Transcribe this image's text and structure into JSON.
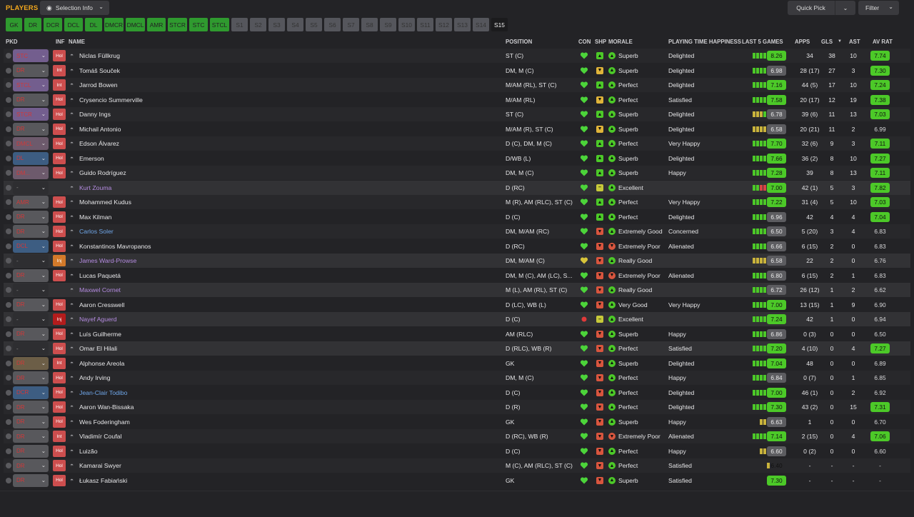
{
  "header": {
    "title": "PLAYERS",
    "selection_info": "Selection Info",
    "quick_pick": "Quick Pick",
    "filter": "Filter"
  },
  "tabs": [
    "GK",
    "DR",
    "DCR",
    "DCL",
    "DL",
    "DMCR",
    "DMCL",
    "AMR",
    "STCR",
    "STC",
    "STCL",
    "S1",
    "S2",
    "S3",
    "S4",
    "S5",
    "S6",
    "S7",
    "S8",
    "S9",
    "S10",
    "S11",
    "S12",
    "S13",
    "S14",
    "S15"
  ],
  "active_tab": "S15",
  "columns": {
    "pkd": "PKD",
    "inf": "INF",
    "name": "NAME",
    "position": "POSITION",
    "con": "CON",
    "shp": "SHP",
    "morale": "MORALE",
    "pth": "PLAYING TIME HAPPINESS",
    "last5": "LAST 5 GAMES",
    "apps": "APPS",
    "gls": "GLS",
    "sort_indicator": "▼",
    "ast": "AST",
    "avrat": "AV RAT"
  },
  "colors": {
    "accent": "#f2a71d",
    "good": "#4cc928",
    "average": "#a8ac2c",
    "danger": "#cd4e4e"
  },
  "players": [
    {
      "sel": "STC",
      "sel_color": "purple",
      "inf": "Hol",
      "name": "Niclas Füllkrug",
      "name_color": "default",
      "position": "ST (C)",
      "con": "heart-green",
      "shp": "up",
      "morale": "Superb",
      "morale_icon": "up",
      "pth": "Delighted",
      "last5": [
        "g",
        "g",
        "g",
        "g",
        "g"
      ],
      "rating": "8.26",
      "rating_color": "g",
      "apps": "34",
      "gls": "38",
      "ast": "10",
      "avrat": "7.74",
      "avrat_color": "g"
    },
    {
      "sel": "DR",
      "sel_color": "grey",
      "inf": "Int",
      "name": "Tomáš Souček",
      "name_color": "default",
      "position": "DM, M (C)",
      "con": "heart-green",
      "shp": "down",
      "morale": "Superb",
      "morale_icon": "up",
      "pth": "Delighted",
      "last5": [
        "g",
        "g",
        "g",
        "g",
        "g"
      ],
      "rating": "6.98",
      "rating_color": "n",
      "apps": "28 (17)",
      "gls": "27",
      "ast": "3",
      "avrat": "7.30",
      "avrat_color": "g"
    },
    {
      "sel": "STCL",
      "sel_color": "purple",
      "inf": "Int",
      "name": "Jarrod Bowen",
      "name_color": "default",
      "position": "M/AM (RL), ST (C)",
      "con": "heart-green",
      "shp": "up",
      "morale": "Perfect",
      "morale_icon": "up",
      "pth": "Delighted",
      "last5": [
        "g",
        "g",
        "g",
        "g",
        "g"
      ],
      "rating": "7.16",
      "rating_color": "g",
      "apps": "44 (5)",
      "gls": "17",
      "ast": "10",
      "avrat": "7.24",
      "avrat_color": "g"
    },
    {
      "sel": "DR",
      "sel_color": "grey",
      "inf": "Hol",
      "name": "Crysencio Summerville",
      "name_color": "default",
      "position": "M/AM (RL)",
      "con": "heart-green",
      "shp": "down",
      "morale": "Perfect",
      "morale_icon": "up",
      "pth": "Satisfied",
      "last5": [
        "g",
        "g",
        "g",
        "g",
        "g"
      ],
      "rating": "7.58",
      "rating_color": "g",
      "apps": "20 (17)",
      "gls": "12",
      "ast": "19",
      "avrat": "7.38",
      "avrat_color": "g"
    },
    {
      "sel": "STCR",
      "sel_color": "purple",
      "inf": "Hol",
      "name": "Danny Ings",
      "name_color": "default",
      "position": "ST (C)",
      "con": "heart-green",
      "shp": "up",
      "morale": "Superb",
      "morale_icon": "up",
      "pth": "Delighted",
      "last5": [
        "y",
        "y",
        "y",
        "g",
        "g"
      ],
      "rating": "6.78",
      "rating_color": "n",
      "apps": "39 (6)",
      "gls": "11",
      "ast": "13",
      "avrat": "7.03",
      "avrat_color": "g"
    },
    {
      "sel": "DR",
      "sel_color": "grey",
      "inf": "Hol",
      "name": "Michail Antonio",
      "name_color": "default",
      "position": "M/AM (R), ST (C)",
      "con": "heart-green",
      "shp": "down",
      "morale": "Superb",
      "morale_icon": "up",
      "pth": "Delighted",
      "last5": [
        "y",
        "y",
        "y",
        "y",
        "g"
      ],
      "rating": "6.58",
      "rating_color": "n",
      "apps": "20 (21)",
      "gls": "11",
      "ast": "2",
      "avrat": "6.99",
      "avrat_color": "none"
    },
    {
      "sel": "DMCL",
      "sel_color": "mauve",
      "inf": "Hol",
      "name": "Edson Álvarez",
      "name_color": "default",
      "position": "D (C), DM, M (C)",
      "con": "heart-green",
      "shp": "up",
      "morale": "Perfect",
      "morale_icon": "up",
      "pth": "Very Happy",
      "last5": [
        "g",
        "g",
        "g",
        "g",
        "g"
      ],
      "rating": "7.70",
      "rating_color": "g",
      "apps": "32 (6)",
      "gls": "9",
      "ast": "3",
      "avrat": "7.11",
      "avrat_color": "g"
    },
    {
      "sel": "DL",
      "sel_color": "blue",
      "inf": "Hol",
      "name": "Emerson",
      "name_color": "default",
      "position": "D/WB (L)",
      "con": "heart-green",
      "shp": "up",
      "morale": "Superb",
      "morale_icon": "up",
      "pth": "Delighted",
      "last5": [
        "g",
        "g",
        "g",
        "g",
        "g"
      ],
      "rating": "7.66",
      "rating_color": "g",
      "apps": "36 (2)",
      "gls": "8",
      "ast": "10",
      "avrat": "7.27",
      "avrat_color": "g"
    },
    {
      "sel": "DM...",
      "sel_color": "mauve",
      "inf": "Hol",
      "name": "Guido Rodríguez",
      "name_color": "default",
      "position": "DM, M (C)",
      "con": "heart-green",
      "shp": "up",
      "morale": "Superb",
      "morale_icon": "up",
      "pth": "Happy",
      "last5": [
        "g",
        "g",
        "g",
        "g",
        "g"
      ],
      "rating": "7.28",
      "rating_color": "g",
      "apps": "39",
      "gls": "8",
      "ast": "13",
      "avrat": "7.11",
      "avrat_color": "g"
    },
    {
      "sel": "-",
      "sel_color": "dark",
      "inf": "",
      "name": "Kurt Zouma",
      "name_color": "purple",
      "position": "D (RC)",
      "con": "heart-green",
      "shp": "neutral",
      "morale": "Excellent",
      "morale_icon": "up",
      "pth": "",
      "last5": [
        "g",
        "g",
        "r",
        "r",
        "g"
      ],
      "rating": "7.00",
      "rating_color": "g",
      "apps": "42 (1)",
      "gls": "5",
      "ast": "3",
      "avrat": "7.82",
      "avrat_color": "g"
    },
    {
      "sel": "AMR",
      "sel_color": "grey",
      "inf": "Hol",
      "name": "Mohammed Kudus",
      "name_color": "default",
      "position": "M (R), AM (RLC), ST (C)",
      "con": "heart-green",
      "shp": "up",
      "morale": "Perfect",
      "morale_icon": "up",
      "pth": "Very Happy",
      "last5": [
        "g",
        "g",
        "g",
        "g",
        "g"
      ],
      "rating": "7.22",
      "rating_color": "g",
      "apps": "31 (4)",
      "gls": "5",
      "ast": "10",
      "avrat": "7.03",
      "avrat_color": "g"
    },
    {
      "sel": "DR",
      "sel_color": "grey",
      "inf": "Hol",
      "name": "Max Kilman",
      "name_color": "default",
      "position": "D (C)",
      "con": "heart-green",
      "shp": "up",
      "morale": "Perfect",
      "morale_icon": "up",
      "pth": "Delighted",
      "last5": [
        "g",
        "g",
        "g",
        "g",
        "g"
      ],
      "rating": "6.96",
      "rating_color": "n",
      "apps": "42",
      "gls": "4",
      "ast": "4",
      "avrat": "7.04",
      "avrat_color": "g"
    },
    {
      "sel": "DR",
      "sel_color": "grey",
      "inf": "Hol",
      "name": "Carlos Soler",
      "name_color": "blue",
      "position": "DM, M/AM (RC)",
      "con": "heart-green",
      "shp": "down-red",
      "morale": "Extremely Good",
      "morale_icon": "up",
      "pth": "Concerned",
      "last5": [
        "g",
        "g",
        "g",
        "g",
        "g"
      ],
      "rating": "6.50",
      "rating_color": "n",
      "apps": "5 (20)",
      "gls": "3",
      "ast": "4",
      "avrat": "6.83",
      "avrat_color": "none"
    },
    {
      "sel": "DCL",
      "sel_color": "blue",
      "inf": "Hol",
      "name": "Konstantinos Mavropanos",
      "name_color": "default",
      "position": "D (RC)",
      "con": "heart-green",
      "shp": "down-red",
      "morale": "Extremely Poor",
      "morale_icon": "down",
      "pth": "Alienated",
      "last5": [
        "g",
        "g",
        "g",
        "g",
        "g"
      ],
      "rating": "6.66",
      "rating_color": "n",
      "apps": "6 (15)",
      "gls": "2",
      "ast": "0",
      "avrat": "6.83",
      "avrat_color": "none"
    },
    {
      "sel": "-",
      "sel_color": "dark",
      "inf": "Inj",
      "name": "James Ward-Prowse",
      "name_color": "purple",
      "position": "DM, M/AM (C)",
      "con": "heart-yellow",
      "shp": "down-red",
      "morale": "Really Good",
      "morale_icon": "up",
      "pth": "",
      "last5": [
        "y",
        "y",
        "y",
        "y",
        "g"
      ],
      "rating": "6.58",
      "rating_color": "n",
      "apps": "22",
      "gls": "2",
      "ast": "0",
      "avrat": "6.76",
      "avrat_color": "none"
    },
    {
      "sel": "DR",
      "sel_color": "grey",
      "inf": "Hol",
      "name": "Lucas Paquetá",
      "name_color": "default",
      "position": "DM, M (C), AM (LC), S...",
      "con": "heart-green",
      "shp": "down-red",
      "morale": "Extremely Poor",
      "morale_icon": "down",
      "pth": "Alienated",
      "last5": [
        "g",
        "g",
        "g",
        "g",
        "g"
      ],
      "rating": "6.80",
      "rating_color": "n",
      "apps": "6 (15)",
      "gls": "2",
      "ast": "1",
      "avrat": "6.83",
      "avrat_color": "none"
    },
    {
      "sel": "-",
      "sel_color": "dark",
      "inf": "",
      "name": "Maxwel Cornet",
      "name_color": "purple",
      "position": "M (L), AM (RL), ST (C)",
      "con": "heart-green",
      "shp": "down-red",
      "morale": "Really Good",
      "morale_icon": "up",
      "pth": "",
      "last5": [
        "g",
        "g",
        "g",
        "g",
        "g"
      ],
      "rating": "6.72",
      "rating_color": "n",
      "apps": "26 (12)",
      "gls": "1",
      "ast": "2",
      "avrat": "6.62",
      "avrat_color": "none"
    },
    {
      "sel": "DR",
      "sel_color": "grey",
      "inf": "Hol",
      "name": "Aaron Cresswell",
      "name_color": "default",
      "position": "D (LC), WB (L)",
      "con": "heart-green",
      "shp": "down-red",
      "morale": "Very Good",
      "morale_icon": "up",
      "pth": "Very Happy",
      "last5": [
        "g",
        "g",
        "g",
        "g",
        "g"
      ],
      "rating": "7.00",
      "rating_color": "g",
      "apps": "13 (15)",
      "gls": "1",
      "ast": "9",
      "avrat": "6.90",
      "avrat_color": "none"
    },
    {
      "sel": "-",
      "sel_color": "dark",
      "inf": "Inj",
      "name": "Nayef Aguerd",
      "name_color": "purple",
      "position": "D (C)",
      "con": "dot-red",
      "shp": "neutral",
      "morale": "Excellent",
      "morale_icon": "up",
      "pth": "",
      "last5": [
        "g",
        "g",
        "g",
        "g",
        "g"
      ],
      "rating": "7.24",
      "rating_color": "g",
      "apps": "42",
      "gls": "1",
      "ast": "0",
      "avrat": "6.94",
      "avrat_color": "none"
    },
    {
      "sel": "DR",
      "sel_color": "grey",
      "inf": "Hol",
      "name": "Luís Guilherme",
      "name_color": "default",
      "position": "AM (RLC)",
      "con": "heart-green",
      "shp": "down-red",
      "morale": "Superb",
      "morale_icon": "up",
      "pth": "Happy",
      "last5": [
        "g",
        "g",
        "g",
        "g",
        "g"
      ],
      "rating": "6.86",
      "rating_color": "n",
      "apps": "0 (3)",
      "gls": "0",
      "ast": "0",
      "avrat": "6.50",
      "avrat_color": "none"
    },
    {
      "sel": "-",
      "sel_color": "dark",
      "inf": "Hol",
      "name": "Omar El Hilali",
      "name_color": "default",
      "position": "D (RLC), WB (R)",
      "con": "heart-green",
      "shp": "down-red",
      "morale": "Perfect",
      "morale_icon": "up",
      "pth": "Satisfied",
      "last5": [
        "g",
        "g",
        "g",
        "g",
        "g"
      ],
      "rating": "7.20",
      "rating_color": "g",
      "apps": "4 (10)",
      "gls": "0",
      "ast": "4",
      "avrat": "7.27",
      "avrat_color": "g"
    },
    {
      "sel": "DR",
      "sel_color": "brown",
      "inf": "Int",
      "name": "Alphonse Areola",
      "name_color": "default",
      "position": "GK",
      "con": "heart-green",
      "shp": "down-red",
      "morale": "Superb",
      "morale_icon": "up",
      "pth": "Delighted",
      "last5": [
        "g",
        "g",
        "g",
        "g",
        "g"
      ],
      "rating": "7.04",
      "rating_color": "g",
      "apps": "48",
      "gls": "0",
      "ast": "0",
      "avrat": "6.89",
      "avrat_color": "none"
    },
    {
      "sel": "DR",
      "sel_color": "grey",
      "inf": "Hol",
      "name": "Andy Irving",
      "name_color": "default",
      "position": "DM, M (C)",
      "con": "heart-green",
      "shp": "down-red",
      "morale": "Perfect",
      "morale_icon": "up",
      "pth": "Happy",
      "last5": [
        "g",
        "g",
        "g",
        "g",
        "g"
      ],
      "rating": "6.84",
      "rating_color": "n",
      "apps": "0 (7)",
      "gls": "0",
      "ast": "1",
      "avrat": "6.85",
      "avrat_color": "none"
    },
    {
      "sel": "DCR",
      "sel_color": "blue",
      "inf": "Hol",
      "name": "Jean-Clair Todibo",
      "name_color": "blue",
      "position": "D (C)",
      "con": "heart-green",
      "shp": "down-red",
      "morale": "Perfect",
      "morale_icon": "up",
      "pth": "Delighted",
      "last5": [
        "g",
        "g",
        "g",
        "g",
        "g"
      ],
      "rating": "7.00",
      "rating_color": "g",
      "apps": "46 (1)",
      "gls": "0",
      "ast": "2",
      "avrat": "6.92",
      "avrat_color": "none"
    },
    {
      "sel": "DR",
      "sel_color": "grey",
      "inf": "Hol",
      "name": "Aaron Wan-Bissaka",
      "name_color": "default",
      "position": "D (R)",
      "con": "heart-green",
      "shp": "down-red",
      "morale": "Perfect",
      "morale_icon": "up",
      "pth": "Delighted",
      "last5": [
        "g",
        "g",
        "g",
        "g",
        "g"
      ],
      "rating": "7.30",
      "rating_color": "g",
      "apps": "43 (2)",
      "gls": "0",
      "ast": "15",
      "avrat": "7.31",
      "avrat_color": "g"
    },
    {
      "sel": "DR",
      "sel_color": "grey",
      "inf": "Hol",
      "name": "Wes Foderingham",
      "name_color": "default",
      "position": "GK",
      "con": "heart-green",
      "shp": "down-red",
      "morale": "Superb",
      "morale_icon": "up",
      "pth": "Happy",
      "last5": [
        "y",
        "y",
        "g"
      ],
      "rating": "6.63",
      "rating_color": "n",
      "apps": "1",
      "gls": "0",
      "ast": "0",
      "avrat": "6.70",
      "avrat_color": "none"
    },
    {
      "sel": "DR",
      "sel_color": "grey",
      "inf": "Int",
      "name": "Vladimír Coufal",
      "name_color": "default",
      "position": "D (RC), WB (R)",
      "con": "heart-green",
      "shp": "down-red",
      "morale": "Extremely Poor",
      "morale_icon": "down",
      "pth": "Alienated",
      "last5": [
        "g",
        "g",
        "g",
        "g",
        "g"
      ],
      "rating": "7.14",
      "rating_color": "g",
      "apps": "2 (15)",
      "gls": "0",
      "ast": "4",
      "avrat": "7.06",
      "avrat_color": "g"
    },
    {
      "sel": "DR",
      "sel_color": "grey",
      "inf": "Hol",
      "name": "Luizão",
      "name_color": "default",
      "position": "D (C)",
      "con": "heart-green",
      "shp": "down-red",
      "morale": "Perfect",
      "morale_icon": "up",
      "pth": "Happy",
      "last5": [
        "y",
        "y",
        "y"
      ],
      "rating": "6.60",
      "rating_color": "n",
      "apps": "0 (2)",
      "gls": "0",
      "ast": "0",
      "avrat": "6.60",
      "avrat_color": "none"
    },
    {
      "sel": "DR",
      "sel_color": "grey",
      "inf": "Hol",
      "name": "Kamarai Swyer",
      "name_color": "default",
      "position": "M (C), AM (RLC), ST (C)",
      "con": "heart-green",
      "shp": "down-red",
      "morale": "Perfect",
      "morale_icon": "up",
      "pth": "Satisfied",
      "last5": [
        "y"
      ],
      "rating": "6.40",
      "rating_color": "none",
      "apps": "-",
      "gls": "-",
      "ast": "-",
      "avrat": "-",
      "avrat_color": "none"
    },
    {
      "sel": "DR",
      "sel_color": "grey",
      "inf": "Hol",
      "name": "Łukasz Fabiański",
      "name_color": "default",
      "position": "GK",
      "con": "heart-green",
      "shp": "down-red",
      "morale": "Superb",
      "morale_icon": "up",
      "pth": "Satisfied",
      "last5": [
        "g"
      ],
      "rating": "7.30",
      "rating_color": "g",
      "apps": "-",
      "gls": "-",
      "ast": "-",
      "avrat": "-",
      "avrat_color": "none"
    }
  ]
}
